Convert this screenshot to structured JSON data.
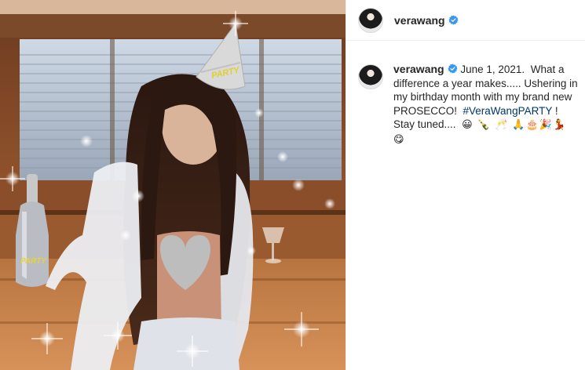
{
  "post": {
    "username": "verawang",
    "verified_color": "#3897f0",
    "caption": {
      "date": "June 1, 2021.",
      "text_main": "What a difference a year makes..... Ushering in my birthday month with my brand new PROSECCO!",
      "hashtag": "#VeraWangPARTY",
      "text_after": "!  Stay tuned....",
      "emojis": "😀 🍾 🥂 🙏🎂🎉💃 😋",
      "emoji_names": [
        "grinning-face",
        "champagne-bottle",
        "clinking-glasses",
        "folded-hands",
        "birthday-cake",
        "party-popper",
        "dancer",
        "savoring-food-face"
      ]
    },
    "photo": {
      "description_icon": "photo-birthday-hat-prosecco",
      "bottle_label": "PARTY",
      "hat_label": "PARTY"
    }
  }
}
